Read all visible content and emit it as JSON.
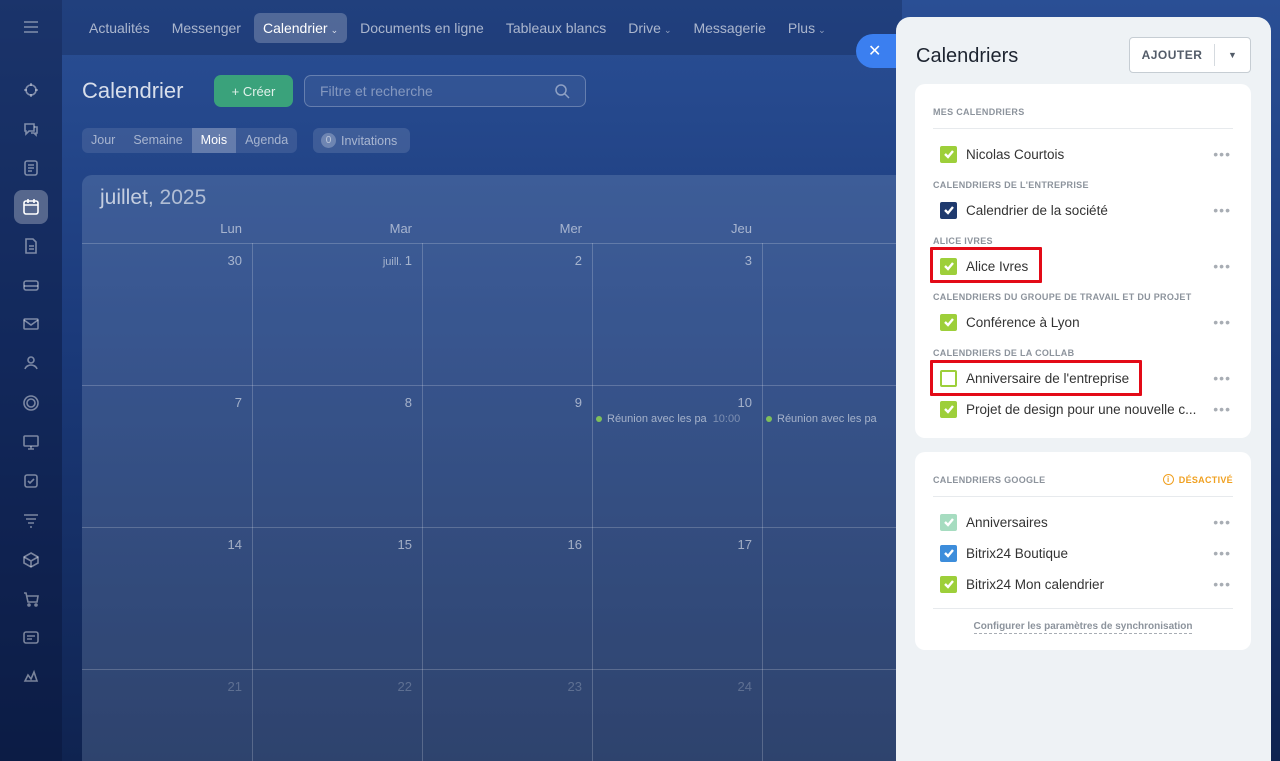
{
  "nav": {
    "tabs": [
      "Actualités",
      "Messenger",
      "Calendrier",
      "Documents en ligne",
      "Tableaux blancs",
      "Drive",
      "Messagerie",
      "Plus"
    ]
  },
  "leftbar_icons": [
    "menu-icon",
    "activity-icon",
    "chat-icon",
    "feed-icon",
    "calendar-icon",
    "document-icon",
    "drive-icon",
    "mail-icon",
    "contacts-icon",
    "target-icon",
    "board-icon",
    "tasks-icon",
    "filter-icon",
    "box-icon",
    "cart-icon",
    "sites-icon",
    "crm-icon"
  ],
  "page": {
    "title": "Calendrier",
    "create_label": "+ Créer",
    "search_placeholder": "Filtre et recherche"
  },
  "views": [
    "Jour",
    "Semaine",
    "Mois",
    "Agenda"
  ],
  "invitations": {
    "count": "0",
    "label": "Invitations"
  },
  "calendar": {
    "month": "juillet,",
    "year": "2025",
    "days": [
      "Lun",
      "Mar",
      "Mer",
      "Jeu"
    ],
    "rows": [
      [
        "30",
        "1",
        "2",
        "3"
      ],
      [
        "7",
        "8",
        "9",
        "10"
      ],
      [
        "14",
        "15",
        "16",
        "17"
      ],
      [
        "21",
        "22",
        "23",
        "24"
      ]
    ],
    "juill_prefix": "juill.",
    "events": [
      {
        "text": "Réunion avec les pa",
        "time": "10:00"
      },
      {
        "text": "Réunion avec les pa",
        "time": ""
      }
    ]
  },
  "panel": {
    "title": "Calendriers",
    "add_label": "AJOUTER",
    "sections": {
      "mine": "MES CALENDRIERS",
      "company": "CALENDRIERS DE L'ENTREPRISE",
      "alice": "ALICE IVRES",
      "group": "CALENDRIERS DU GROUPE DE TRAVAIL ET DU PROJET",
      "collab": "CALENDRIERS DE LA COLLAB",
      "google": "CALENDRIERS GOOGLE"
    },
    "items": {
      "nicolas": "Nicolas Courtois",
      "societe": "Calendrier de la société",
      "alice": "Alice Ivres",
      "lyon": "Conférence à Lyon",
      "anniv_ent": "Anniversaire de l'entreprise",
      "design": "Projet de design pour une nouvelle c...",
      "anniversaires": "Anniversaires",
      "boutique": "Bitrix24 Boutique",
      "mon_cal": "Bitrix24 Mon calendrier"
    },
    "google_status": "DÉSACTIVÉ",
    "sync_link": "Configurer les paramètres de synchronisation",
    "colors": {
      "green": "#9dcf3a",
      "navy": "#1f3a6e",
      "lightgreen": "#a6dcc0",
      "blue": "#3d8ddb"
    }
  }
}
